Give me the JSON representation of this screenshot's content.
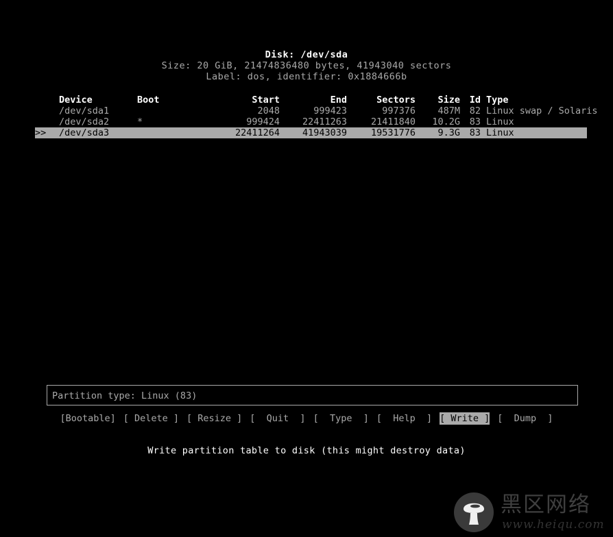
{
  "disk": {
    "title": "Disk: /dev/sda",
    "size_line": "Size: 20 GiB, 21474836480 bytes, 41943040 sectors",
    "label_line": "Label: dos, identifier: 0x1884666b"
  },
  "table": {
    "headers": {
      "device": "Device",
      "boot": "Boot",
      "start": "Start",
      "end": "End",
      "sectors": "Sectors",
      "size": "Size",
      "id": "Id",
      "type": "Type"
    },
    "rows": [
      {
        "cursor": "",
        "device": "/dev/sda1",
        "boot": "",
        "start": "2048",
        "end": "999423",
        "sectors": "997376",
        "size": "487M",
        "id": "82",
        "type": "Linux swap / Solaris",
        "selected": false
      },
      {
        "cursor": "",
        "device": "/dev/sda2",
        "boot": "*",
        "start": "999424",
        "end": "22411263",
        "sectors": "21411840",
        "size": "10.2G",
        "id": "83",
        "type": "Linux",
        "selected": false
      },
      {
        "cursor": ">>",
        "device": "/dev/sda3",
        "boot": "",
        "start": "22411264",
        "end": "41943039",
        "sectors": "19531776",
        "size": "9.3G",
        "id": "83",
        "type": "Linux",
        "selected": true
      }
    ]
  },
  "info_box": {
    "text": "Partition type: Linux (83)"
  },
  "menu": {
    "items": [
      {
        "label": "[Bootable]",
        "name": "bootable",
        "active": false
      },
      {
        "label": "[ Delete ]",
        "name": "delete",
        "active": false
      },
      {
        "label": "[ Resize ]",
        "name": "resize",
        "active": false
      },
      {
        "label": "[  Quit  ]",
        "name": "quit",
        "active": false
      },
      {
        "label": "[  Type  ]",
        "name": "type",
        "active": false
      },
      {
        "label": "[  Help  ]",
        "name": "help",
        "active": false
      },
      {
        "label": "[ Write ]",
        "name": "write",
        "active": true
      },
      {
        "label": "[  Dump  ]",
        "name": "dump",
        "active": false
      }
    ]
  },
  "status": {
    "text": "Write partition table to disk (this might destroy data)"
  },
  "watermark": {
    "brand_cn": "黑区网络",
    "url": "www.heiqu.com",
    "badge_color": "#3a3a3a",
    "text_color": "#3f3f3f"
  },
  "colors": {
    "background": "#000000",
    "bright_text": "#ffffff",
    "normal_text": "#aaaaaa",
    "highlight_bg": "#aaaaaa",
    "highlight_fg": "#000000"
  }
}
